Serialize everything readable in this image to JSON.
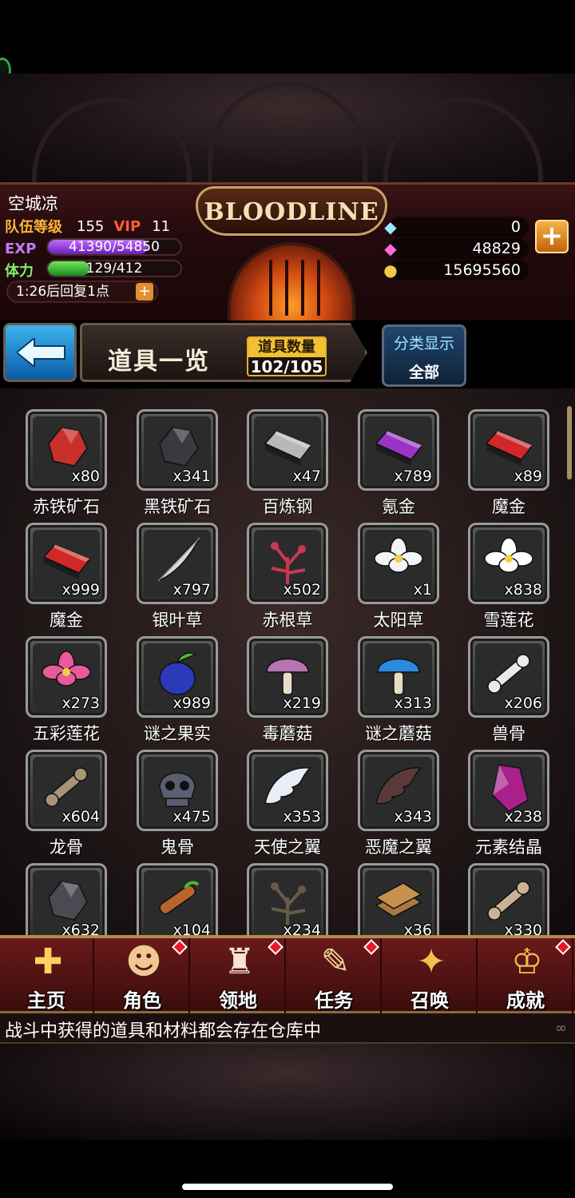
{
  "player": {
    "name": "空城凉",
    "team_level_label": "队伍等级",
    "team_level": "155",
    "vip_label": "VIP",
    "vip": "11",
    "exp_label": "EXP",
    "exp": "41390/54850",
    "exp_fraction": 0.755,
    "stamina_label": "体力",
    "stamina": "129/412",
    "stamina_fraction": 0.313,
    "recover_text": "1:26后回复1点"
  },
  "logo_text": "BLOODLINE",
  "resources": {
    "crystal": "0",
    "gem": "48829",
    "gold": "15695560"
  },
  "titlebar": {
    "title": "道具一览",
    "count_label": "道具数量",
    "count_value": "102/105",
    "category_label": "分类显示",
    "category_value": "全部"
  },
  "items": [
    {
      "name": "赤铁矿石",
      "qty": "x80",
      "icon": "red-ore-icon",
      "color": "#c8302c"
    },
    {
      "name": "黑铁矿石",
      "qty": "x341",
      "icon": "black-ore-icon",
      "color": "#3a3a3e"
    },
    {
      "name": "百炼钢",
      "qty": "x47",
      "icon": "steel-ingot-icon",
      "color": "#b8b8b8"
    },
    {
      "name": "氪金",
      "qty": "x789",
      "icon": "purple-ingot-icon",
      "color": "#9a34c8"
    },
    {
      "name": "魔金",
      "qty": "x89",
      "icon": "red-ingot-icon",
      "color": "#d02828"
    },
    {
      "name": "魔金",
      "qty": "x999",
      "icon": "red-ingot-icon",
      "color": "#d02828"
    },
    {
      "name": "银叶草",
      "qty": "x797",
      "icon": "silver-leaf-icon",
      "color": "#d8d8e0"
    },
    {
      "name": "赤根草",
      "qty": "x502",
      "icon": "red-root-herb-icon",
      "color": "#c83850"
    },
    {
      "name": "太阳草",
      "qty": "x1",
      "icon": "white-flower-icon",
      "color": "#f4f4f4"
    },
    {
      "name": "雪莲花",
      "qty": "x838",
      "icon": "snow-lotus-icon",
      "color": "#ffffff"
    },
    {
      "name": "五彩莲花",
      "qty": "x273",
      "icon": "rainbow-lotus-icon",
      "color": "#e85a9a"
    },
    {
      "name": "谜之果实",
      "qty": "x989",
      "icon": "mystery-fruit-icon",
      "color": "#2a3ab8"
    },
    {
      "name": "毒蘑菇",
      "qty": "x219",
      "icon": "poison-mushroom-icon",
      "color": "#b874b0"
    },
    {
      "name": "谜之蘑菇",
      "qty": "x313",
      "icon": "blue-mushroom-icon",
      "color": "#2a8ae0"
    },
    {
      "name": "兽骨",
      "qty": "x206",
      "icon": "bone-icon",
      "color": "#eaeaea"
    },
    {
      "name": "龙骨",
      "qty": "x604",
      "icon": "dragon-bone-icon",
      "color": "#a89478"
    },
    {
      "name": "鬼骨",
      "qty": "x475",
      "icon": "skull-icon",
      "color": "#5a5e70"
    },
    {
      "name": "天使之翼",
      "qty": "x353",
      "icon": "angel-wing-icon",
      "color": "#e8eef8"
    },
    {
      "name": "恶魔之翼",
      "qty": "x343",
      "icon": "demon-wing-icon",
      "color": "#5a3a38"
    },
    {
      "name": "元素结晶",
      "qty": "x238",
      "icon": "element-crystal-icon",
      "color": "#a8208a"
    },
    {
      "name": "",
      "qty": "x632",
      "icon": "dark-gem-icon",
      "color": "#4a4a52"
    },
    {
      "name": "",
      "qty": "x104",
      "icon": "wood-branch-icon",
      "color": "#b8642a"
    },
    {
      "name": "",
      "qty": "x234",
      "icon": "twig-icon",
      "color": "#6a5a4a"
    },
    {
      "name": "",
      "qty": "x36",
      "icon": "wood-planks-icon",
      "color": "#a87a42"
    },
    {
      "name": "",
      "qty": "x330",
      "icon": "log-icon",
      "color": "#c8b494"
    }
  ],
  "nav": [
    {
      "label": "主页",
      "icon": "home-shield-icon",
      "badge": false
    },
    {
      "label": "角色",
      "icon": "character-icon",
      "badge": true
    },
    {
      "label": "领地",
      "icon": "castle-icon",
      "badge": true
    },
    {
      "label": "任务",
      "icon": "quest-book-icon",
      "badge": true
    },
    {
      "label": "召唤",
      "icon": "summon-card-icon",
      "badge": false
    },
    {
      "label": "成就",
      "icon": "trophy-icon",
      "badge": true
    }
  ],
  "tip": "战斗中获得的道具和材料都会存在仓库中"
}
